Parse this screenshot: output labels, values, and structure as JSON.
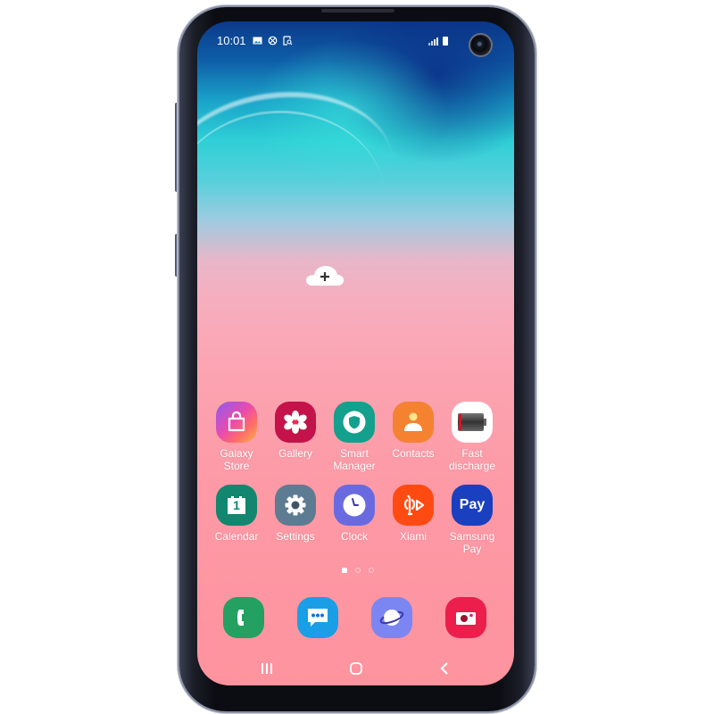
{
  "status_bar": {
    "time": "10:01",
    "left_icons": [
      "image-icon",
      "no-sync-icon",
      "screenshot-search-icon"
    ],
    "right_icons": [
      "signal-icon",
      "battery-icon"
    ]
  },
  "home": {
    "add_widget_icon": "cloud-plus-icon",
    "apps": [
      {
        "label": "Galaxy Store",
        "icon": "shopping-bag-icon",
        "color": "#e65aa8"
      },
      {
        "label": "Gallery",
        "icon": "flower-icon",
        "color": "#c4124a"
      },
      {
        "label": "Smart Manager",
        "icon": "shield-icon",
        "color": "#13a08c"
      },
      {
        "label": "Contacts",
        "icon": "person-icon",
        "color": "#f58231"
      },
      {
        "label": "Fast discharge",
        "icon": "battery-low-icon",
        "color": "#ffffff"
      },
      {
        "label": "Calendar",
        "icon": "calendar-icon",
        "color": "#12866f"
      },
      {
        "label": "Settings",
        "icon": "gear-icon",
        "color": "#5d7c92"
      },
      {
        "label": "Clock",
        "icon": "clock-icon",
        "color": "#6a6ae0"
      },
      {
        "label": "Xiami",
        "icon": "xiami-icon",
        "color": "#ff4b12"
      },
      {
        "label": "Samsung Pay",
        "icon": "pay-icon",
        "color": "#1a3fbf",
        "text": "Pay"
      }
    ],
    "calendar_day": "1",
    "pages": {
      "count": 3,
      "current": 1,
      "home_indicator": true
    }
  },
  "dock": [
    {
      "name": "Phone",
      "icon": "phone-icon",
      "color": "#24a060"
    },
    {
      "name": "Messages",
      "icon": "message-icon",
      "color": "#1a9fe6"
    },
    {
      "name": "Internet",
      "icon": "planet-icon",
      "color": "#7c86f2"
    },
    {
      "name": "Camera",
      "icon": "camera-icon",
      "color": "#ec1e4c"
    }
  ],
  "nav_bar": {
    "recents": "recents-icon",
    "home": "home-icon",
    "back": "back-icon"
  }
}
